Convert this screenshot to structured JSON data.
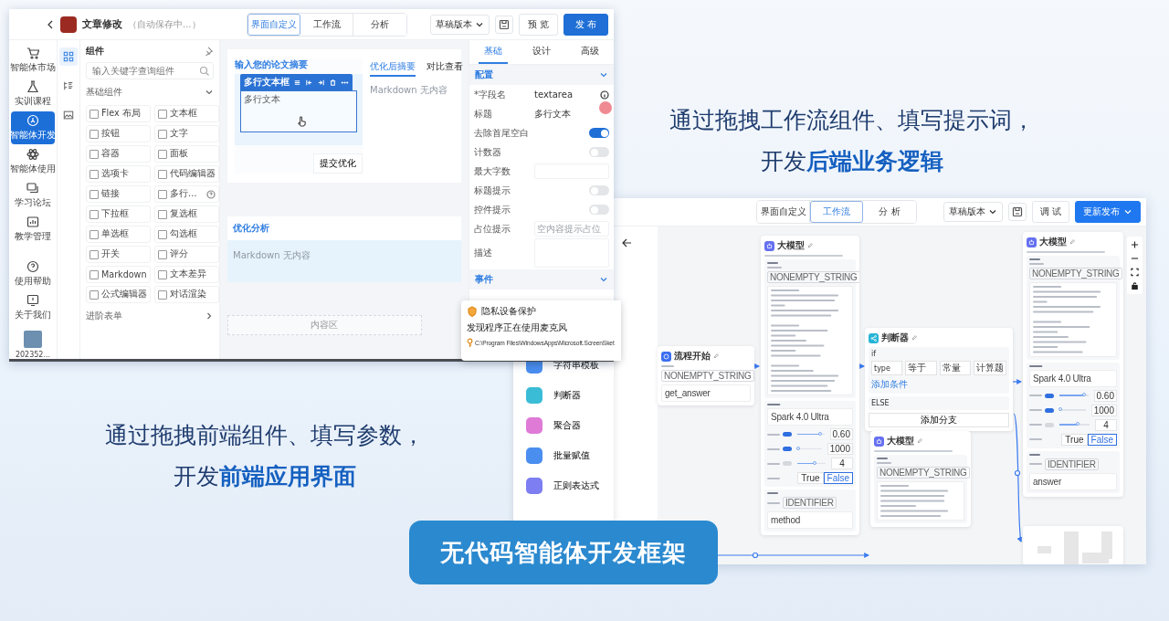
{
  "editor": {
    "app_title": "文章修改",
    "save_status": "（自动保存中...）",
    "mode_tabs": [
      {
        "label": "界面自定义",
        "selected": true
      },
      {
        "label": "工作流",
        "selected": false
      },
      {
        "label": "分析",
        "selected": false
      }
    ],
    "version": "草稿版本",
    "preview": "预 览",
    "publish": "发 布",
    "nav": [
      {
        "label": "智能体市场",
        "kind": "cart",
        "selected": false
      },
      {
        "label": "实训课程",
        "kind": "flask",
        "selected": false
      },
      {
        "label": "智能体开发",
        "kind": "dev",
        "selected": true
      },
      {
        "label": "智能体使用",
        "kind": "atom",
        "selected": false
      },
      {
        "label": "学习论坛",
        "kind": "forum",
        "selected": false
      },
      {
        "label": "教学管理",
        "kind": "chart",
        "selected": false
      },
      {
        "label": "使用帮助",
        "kind": "help",
        "selected": false
      },
      {
        "label": "关于我们",
        "kind": "about",
        "selected": false
      }
    ],
    "user_label": "202352...",
    "side_tabs": [
      {
        "kind": "grid",
        "selected": true
      },
      {
        "kind": "tree",
        "selected": false
      },
      {
        "kind": "image",
        "selected": false
      }
    ],
    "components": {
      "title": "组件",
      "search_placeholder": "输入关键字查询组件",
      "groups": [
        {
          "title": "基础组件",
          "expanded": true,
          "items": [
            {
              "label": "Flex 布局"
            },
            {
              "label": "文本框"
            },
            {
              "label": "按钮"
            },
            {
              "label": "文字"
            },
            {
              "label": "容器"
            },
            {
              "label": "面板"
            },
            {
              "label": "选项卡"
            },
            {
              "label": "代码编辑器"
            },
            {
              "label": "链接"
            },
            {
              "label": "多行…",
              "help": true
            },
            {
              "label": "下拉框"
            },
            {
              "label": "复选框"
            },
            {
              "label": "单选框"
            },
            {
              "label": "勾选框"
            },
            {
              "label": "开关"
            },
            {
              "label": "评分"
            },
            {
              "label": "Markdown"
            },
            {
              "label": "文本差异"
            },
            {
              "label": "公式编辑器"
            },
            {
              "label": "对话渲染"
            }
          ]
        },
        {
          "title": "进阶表单",
          "expanded": false
        }
      ]
    },
    "canvas": {
      "input_label": "输入您的论文摘要",
      "toolbar_label": "多行文本框",
      "textarea_value": "多行文本",
      "submit": "提交优化",
      "result_tabs": [
        {
          "label": "优化后摘要",
          "selected": true
        },
        {
          "label": "对比查看",
          "selected": false
        }
      ],
      "result_placeholder": "Markdown 无内容",
      "analysis_title": "优化分析",
      "analysis_placeholder": "Markdown 无内容",
      "content_area": "内容区"
    },
    "props": {
      "tabs": [
        {
          "label": "基础",
          "selected": true
        },
        {
          "label": "设计",
          "selected": false
        },
        {
          "label": "高级",
          "selected": false
        }
      ],
      "section": "配置",
      "fields": [
        {
          "kind": "text",
          "label": "*字段名",
          "value": "textarea",
          "info": true
        },
        {
          "kind": "text",
          "label": "标题",
          "value": "多行文本",
          "info": false
        },
        {
          "kind": "switch",
          "label": "去除首尾空白",
          "on": true
        },
        {
          "kind": "switch",
          "label": "计数器",
          "on": false
        },
        {
          "kind": "input",
          "label": "最大字数"
        },
        {
          "kind": "switch",
          "label": "标题提示",
          "on": false
        },
        {
          "kind": "switch",
          "label": "控件提示",
          "on": false
        },
        {
          "kind": "input",
          "label": "占位提示",
          "placeholder": "空内容提示占位"
        },
        {
          "kind": "textarea",
          "label": "描述"
        }
      ],
      "events": "事件"
    }
  },
  "toast": {
    "title": "隐私设备保护",
    "message": "发现程序正在使用麦克风",
    "path": "C:\\Program Files\\WindowsApps\\Microsoft.ScreenSket"
  },
  "node_panel": {
    "items": [
      {
        "label": "字符串模板",
        "color": "#4a8ef0"
      },
      {
        "label": "判断器",
        "color": "#3bbcd6"
      },
      {
        "label": "聚合器",
        "color": "#df7ad6"
      },
      {
        "label": "批量赋值",
        "color": "#4a8ef0"
      },
      {
        "label": "正则表达式",
        "color": "#7c7ef2"
      }
    ]
  },
  "workflow": {
    "mode_tabs": [
      {
        "label": "界面自定义",
        "selected": false
      },
      {
        "label": "工作流",
        "selected": true
      },
      {
        "label": "分 析",
        "selected": false
      }
    ],
    "version": "草稿版本",
    "debug": "调 试",
    "publish": "更新发布",
    "nodes": [
      {
        "kind": "start",
        "title": "流程开始",
        "type": "NONEMPTY_STRING",
        "value": "get_answer"
      },
      {
        "kind": "llm",
        "title": "大模型",
        "input_type": "NONEMPTY_STRING",
        "model": "Spark 4.0 Ultra",
        "params": [
          {
            "on": true,
            "level": 0.85,
            "value": "0.60"
          },
          {
            "on": true,
            "level": 0.05,
            "value": "1000"
          },
          {
            "on": false,
            "level": 0.6,
            "value": "4"
          }
        ],
        "bool": [
          {
            "label": "True",
            "selected": false
          },
          {
            "label": "False",
            "selected": true
          }
        ],
        "output_type": "IDENTIFIER",
        "output": "method"
      },
      {
        "kind": "judge",
        "title": "判断器",
        "if_label": "if",
        "conditions": [
          "type",
          "等于",
          "常量",
          "计算题"
        ],
        "add_condition": "添加条件",
        "else_label": "ELSE",
        "add_branch": "添加分支"
      },
      {
        "kind": "llm",
        "title": "大模型",
        "input_type": "NONEMPTY_STRING"
      },
      {
        "kind": "llm",
        "title": "大模型",
        "input_type": "NONEMPTY_STRING",
        "model": "Spark 4.0 Ultra",
        "params": [
          {
            "on": true,
            "level": 0.85,
            "value": "0.60"
          },
          {
            "on": true,
            "level": 0.05,
            "value": "1000"
          },
          {
            "on": false,
            "level": 0.6,
            "value": "4"
          }
        ],
        "bool": [
          {
            "label": "True",
            "selected": false
          },
          {
            "label": "False",
            "selected": true
          }
        ],
        "output_type": "IDENTIFIER",
        "output": "answer"
      },
      {
        "kind": "skeleton"
      }
    ]
  },
  "headlines": [
    {
      "line1": "通过拖拽工作流组件、填写提示词，",
      "line2": "开发**后端业务逻辑**"
    },
    {
      "line1": "通过拖拽前端组件、填写参数，",
      "line2": "开发**前端应用界面**"
    }
  ],
  "badge": "无代码智能体开发框架"
}
